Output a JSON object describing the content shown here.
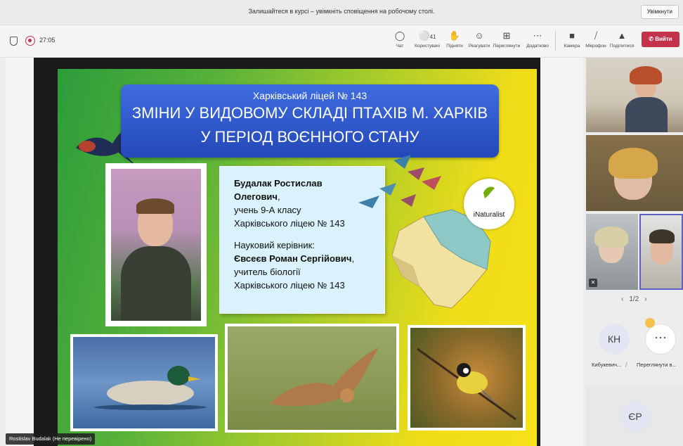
{
  "notification": {
    "text": "Залишайтеся в курсі – увімкніть сповіщення на робочому столі.",
    "button": "Увімкнути"
  },
  "toolbar": {
    "timer": "27:05",
    "buttons": [
      {
        "label": "Чат",
        "icon": "chat-icon"
      },
      {
        "label": "Користувачі",
        "icon": "people-icon",
        "count": "41"
      },
      {
        "label": "Підняти",
        "icon": "raise-hand-icon"
      },
      {
        "label": "Реагувати",
        "icon": "react-icon"
      },
      {
        "label": "Переглянути",
        "icon": "view-icon"
      },
      {
        "label": "Додатково",
        "icon": "more-icon"
      },
      {
        "label": "Камера",
        "icon": "camera-off-icon"
      },
      {
        "label": "Мікрофон",
        "icon": "mic-off-icon"
      },
      {
        "label": "Поділитися",
        "icon": "share-icon"
      }
    ],
    "leave": "Вийти"
  },
  "slide": {
    "school": "Харківський ліцей № 143",
    "title_line1": "ЗМІНИ У ВИДОВОМУ СКЛАДІ ПТАХІВ М. ХАРКІВ",
    "title_line2": "У ПЕРІОД ВОЄННОГО СТАНУ",
    "author_name": "Будалак Ростислав Олегович",
    "author_name_suffix": ",",
    "author_role": "учень 9-А класу",
    "author_school": "Харківського ліцею № 143",
    "supervisor_label": "Науковий керівник:",
    "supervisor_name": "Євсеєв Роман Сергійович",
    "supervisor_name_suffix": ",",
    "supervisor_role": "учитель біології",
    "supervisor_school": "Харківського ліцею № 143",
    "logo": "iNaturalist"
  },
  "presenter_caption": "Rostislav Budalak (Не перевірено)",
  "participants": {
    "pager": "1/2",
    "avatar1_initials": "КН",
    "avatar1_name": "Кибукевич...",
    "avatar2_name": "Переглянути в...",
    "avatar3_initials": "ЄР"
  },
  "colors": {
    "leave": "#c4314b",
    "title_box": "#2f57cc",
    "active_tile": "#5b5fc7"
  }
}
